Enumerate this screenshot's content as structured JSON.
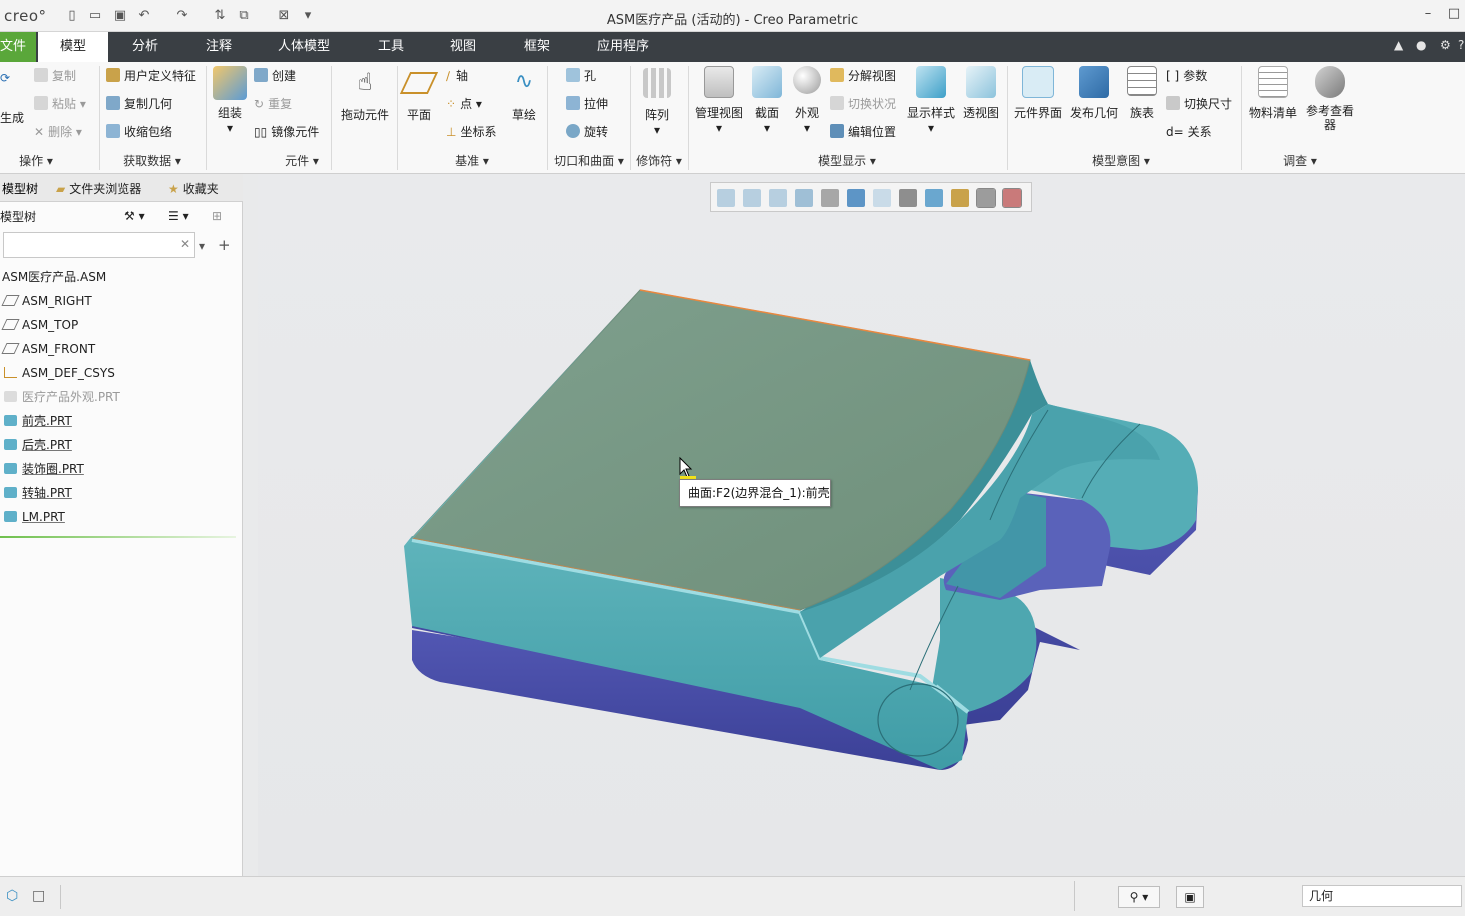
{
  "titlebar": {
    "logo": "creo°",
    "title": "ASM医疗产品 (活动的) - Creo Parametric",
    "minimize": "–",
    "maximize": "□"
  },
  "tabs": [
    "文件",
    "模型",
    "分析",
    "注释",
    "人体模型",
    "工具",
    "视图",
    "框架",
    "应用程序"
  ],
  "ribbon": {
    "ops": {
      "regen": "生成",
      "copy": "复制",
      "paste": "粘贴",
      "delete": "删除",
      "group": "操作"
    },
    "getdata": {
      "udf": "用户定义特征",
      "copygeom": "复制几何",
      "shrinkwrap": "收缩包络",
      "group": "获取数据"
    },
    "component": {
      "assemble": "组装",
      "create": "创建",
      "repeat": "重复",
      "mirror": "镜像元件",
      "group": "元件"
    },
    "drag": {
      "label": "拖动元件"
    },
    "datum": {
      "plane": "平面",
      "axis": "轴",
      "point": "点",
      "csys": "坐标系",
      "sketch": "草绘",
      "group": "基准"
    },
    "cut": {
      "hole": "孔",
      "extrude": "拉伸",
      "revolve": "旋转",
      "group": "切口和曲面"
    },
    "modifier": {
      "pattern": "阵列",
      "group": "修饰符"
    },
    "display": {
      "manageviews": "管理视图",
      "section": "截面",
      "appearance": "外观",
      "explode": "分解视图",
      "togglestatus": "切换状况",
      "editpos": "编辑位置",
      "dispstyle": "显示样式",
      "perspective": "透视图",
      "group": "模型显示"
    },
    "intent": {
      "interface": "元件界面",
      "publish": "发布几何",
      "family": "族表",
      "params": "参数",
      "switchdim": "切换尺寸",
      "relations": "关系",
      "group": "模型意图"
    },
    "investigate": {
      "bom": "物料清单",
      "refviewer": "参考查看器",
      "group": "调查"
    }
  },
  "leftpanel": {
    "tabs": [
      "模型树",
      "文件夹浏览器",
      "收藏夹"
    ],
    "tree_header": "模型树",
    "search_value": "",
    "items": [
      {
        "label": "ASM医疗产品.ASM",
        "kind": "root"
      },
      {
        "label": "ASM_RIGHT",
        "kind": "plane"
      },
      {
        "label": "ASM_TOP",
        "kind": "plane"
      },
      {
        "label": "ASM_FRONT",
        "kind": "plane"
      },
      {
        "label": "ASM_DEF_CSYS",
        "kind": "csys"
      },
      {
        "label": "医疗产品外观.PRT",
        "kind": "dim"
      },
      {
        "label": "前壳.PRT",
        "kind": "prt"
      },
      {
        "label": "后壳.PRT",
        "kind": "prt"
      },
      {
        "label": "装饰圈.PRT",
        "kind": "prt"
      },
      {
        "label": "转轴.PRT",
        "kind": "prt"
      },
      {
        "label": "LM.PRT",
        "kind": "prt"
      }
    ]
  },
  "graphics": {
    "tooltip": "曲面:F2(边界混合_1):前壳"
  },
  "statusbar": {
    "filter": "几何"
  },
  "colors": {
    "tab_active": "#5aa73a",
    "tabbar": "#3a3f44",
    "teal": "#4ea7b0",
    "top_face": "#7a9884",
    "blue": "#4a4fa3"
  }
}
